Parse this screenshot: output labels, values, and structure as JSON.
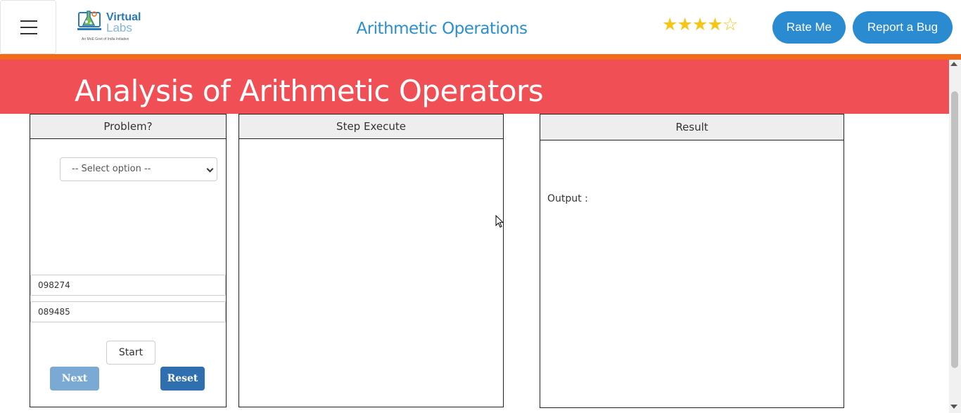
{
  "navbar": {
    "logo": {
      "word1": "Virtual",
      "word2": "Labs",
      "tagline": "An MoE Govt of India Initiative"
    },
    "title": "Arithmetic Operations",
    "rating": {
      "value": 4,
      "max": 5,
      "star_color": "#f5c518"
    },
    "rate_button": "Rate Me",
    "bug_button": "Report a Bug",
    "accent_color": "#2a8bd1",
    "strip_color": "#f26b1d"
  },
  "banner": {
    "title": "Analysis of Arithmetic Operators",
    "color": "#f04f55"
  },
  "panels": {
    "problem": {
      "header": "Problem?",
      "select_value": "-- Select option --",
      "input1": "098274",
      "input2": "089485",
      "start_label": "Start",
      "next_label": "Next",
      "reset_label": "Reset"
    },
    "step": {
      "header": "Step Execute"
    },
    "result": {
      "header": "Result",
      "output_label": "Output :"
    }
  }
}
